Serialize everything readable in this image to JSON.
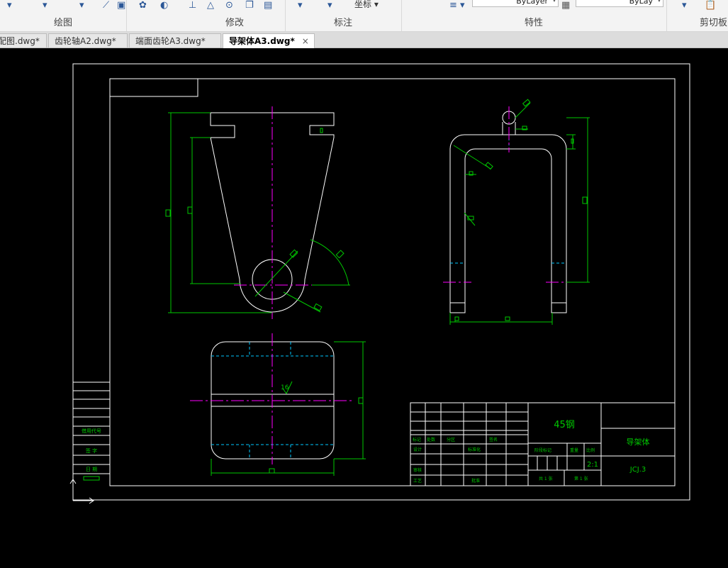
{
  "ribbon": {
    "groups": [
      {
        "id": "draw",
        "title": "绘图"
      },
      {
        "id": "modify",
        "title": "修改"
      },
      {
        "id": "annotate",
        "title": "标注",
        "coord_label": "坐标"
      },
      {
        "id": "properties",
        "title": "特性",
        "linetype": "ByLayer",
        "lineweight": "ByLay"
      },
      {
        "id": "clipboard",
        "title": "剪切板"
      }
    ]
  },
  "tabs": [
    {
      "label": "配图.dwg*",
      "active": false
    },
    {
      "label": "齿轮轴A2.dwg*",
      "active": false
    },
    {
      "label": "端面齿轮A3.dwg*",
      "active": false
    },
    {
      "label": "导架体A3.dwg*",
      "active": true
    }
  ],
  "tab_close": "×",
  "drawing": {
    "surface_mark": "16",
    "left_strip": [
      "借用代号",
      "签 字",
      "日 期"
    ],
    "title_block": {
      "material": "45钢",
      "part_name": "导架体",
      "drawing_no": "JCJ.3",
      "scale": "2:1",
      "row_labels": [
        "标记",
        "处数",
        "分区",
        "签名"
      ],
      "design_label": "设计",
      "standardize_label": "标准化",
      "review_label": "审核",
      "process_label": "工艺",
      "approve_label": "批准",
      "stage_label": "阶段标记",
      "weight_label": "重量",
      "scale_label": "比例",
      "sheets_total": "共 1 张",
      "sheet_no": "第 1 张"
    }
  },
  "colors": {
    "background": "#000000",
    "outline": "#ffffff",
    "dimension": "#00c800",
    "centerline": "#ff00ff",
    "hidden": "#00c8ff"
  }
}
